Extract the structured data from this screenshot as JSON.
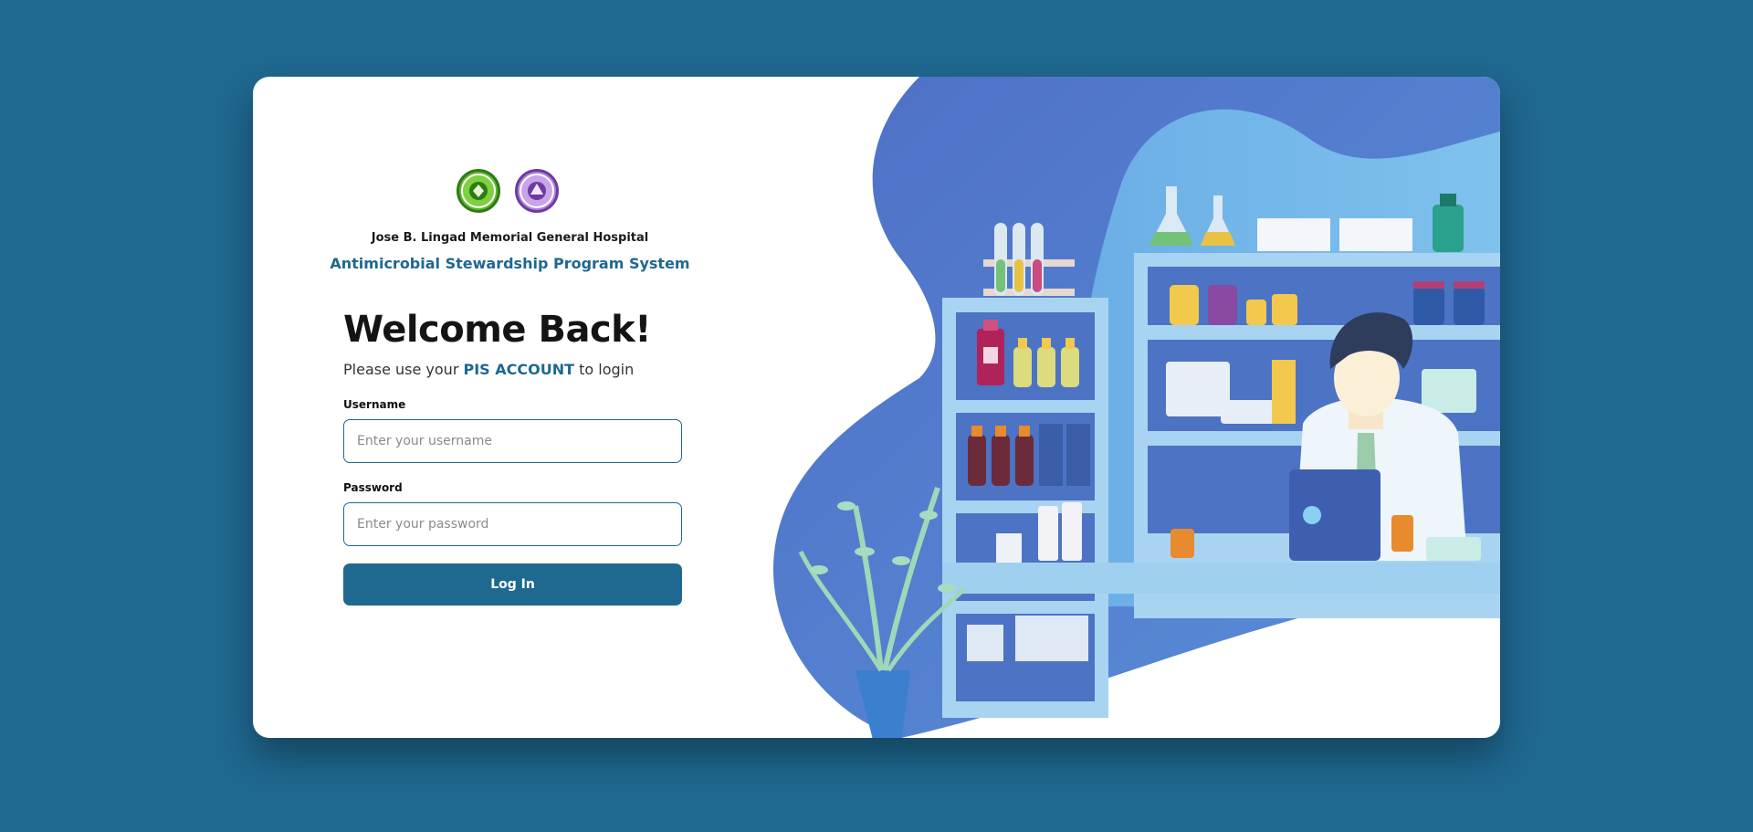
{
  "header": {
    "hospital_name": "Jose B. Lingad Memorial General Hospital",
    "system_name": "Antimicrobial Stewardship Program System"
  },
  "logos": [
    {
      "icon": "hospital-seal-icon",
      "color": "#5cb82a"
    },
    {
      "icon": "province-seal-icon",
      "color": "#b084d8"
    }
  ],
  "login": {
    "title": "Welcome Back!",
    "subtitle_prefix": "Please use your ",
    "subtitle_accent": "PIS ACCOUNT",
    "subtitle_suffix": " to login",
    "username_label": "Username",
    "username_placeholder": "Enter your username",
    "password_label": "Password",
    "password_placeholder": "Enter your password",
    "submit_label": "Log In"
  },
  "colors": {
    "background": "#1f6890",
    "accent": "#1f6890",
    "card": "#ffffff"
  },
  "illustration": {
    "icon": "pharmacist-illustration"
  }
}
